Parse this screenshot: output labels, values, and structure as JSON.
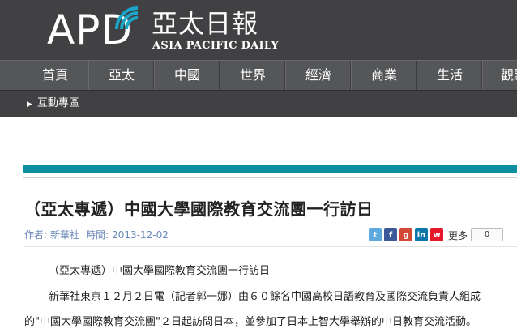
{
  "header": {
    "logo_apd": "APD",
    "logo_cn": "亞太日報",
    "logo_en": "ASIA PACIFIC DAILY"
  },
  "nav": {
    "items": [
      "首頁",
      "亞太",
      "中國",
      "世界",
      "經濟",
      "商業",
      "生活",
      "觀點"
    ]
  },
  "subnav": {
    "label": "互動專區"
  },
  "article": {
    "title": "（亞太專遞）中國大學國際教育交流團一行訪日",
    "author_label": "作者:",
    "author": "新華社",
    "time_label": "時間:",
    "date": "2013-12-02",
    "paragraphs": [
      "（亞太專遞）中國大學國際教育交流團一行訪日",
      "新華社東京１２月２日電（記者郭一娜）由６０餘名中國高校日語教育及國際交流負責人組成",
      "的\"中國大學國際教育交流團\"２日起訪問日本，並參加了日本上智大學舉辦的中日教育交流活動。"
    ]
  },
  "share": {
    "more_label": "更多",
    "count": "0",
    "icons": [
      "twitter-icon",
      "facebook-icon",
      "google-plus-icon",
      "linkedin-icon",
      "weibo-icon"
    ]
  },
  "colors": {
    "header_bg": "#414143",
    "nav_bg": "#555658",
    "accent_teal": "#0d8da1",
    "meta_blue": "#6a88b8"
  }
}
